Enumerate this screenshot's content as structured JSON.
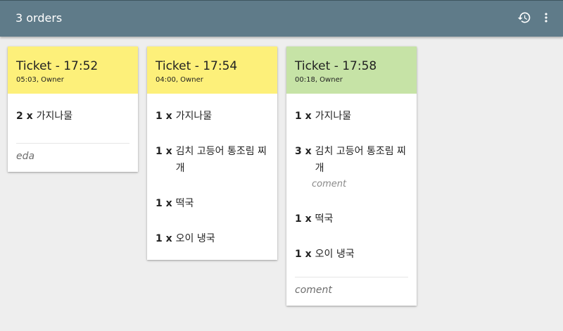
{
  "appbar": {
    "title": "3 orders",
    "history_icon": "history-icon",
    "more_icon": "more-vert-icon"
  },
  "colors": {
    "appbar": "#5f7b89",
    "pending": "#fdf07a",
    "ready": "#c6e3a6"
  },
  "tickets": [
    {
      "title": "Ticket - 17:52",
      "sub": "05:03, Owner",
      "status": "pending",
      "items": [
        {
          "qty": "2 x",
          "name": "가지나물"
        }
      ],
      "note": "eda"
    },
    {
      "title": "Ticket - 17:54",
      "sub": "04:00, Owner",
      "status": "pending",
      "items": [
        {
          "qty": "1 x",
          "name": "가지나물"
        },
        {
          "qty": "1 x",
          "name": "김치 고등어 통조림 찌개"
        },
        {
          "qty": "1 x",
          "name": "떡국"
        },
        {
          "qty": "1 x",
          "name": "오이 냉국"
        }
      ]
    },
    {
      "title": "Ticket - 17:58",
      "sub": "00:18, Owner",
      "status": "ready",
      "items": [
        {
          "qty": "1 x",
          "name": "가지나물"
        },
        {
          "qty": "3 x",
          "name": "김치 고등어 통조림 찌개",
          "note": "coment"
        },
        {
          "qty": "1 x",
          "name": "떡국"
        },
        {
          "qty": "1 x",
          "name": "오이 냉국"
        }
      ],
      "note": "coment"
    }
  ]
}
